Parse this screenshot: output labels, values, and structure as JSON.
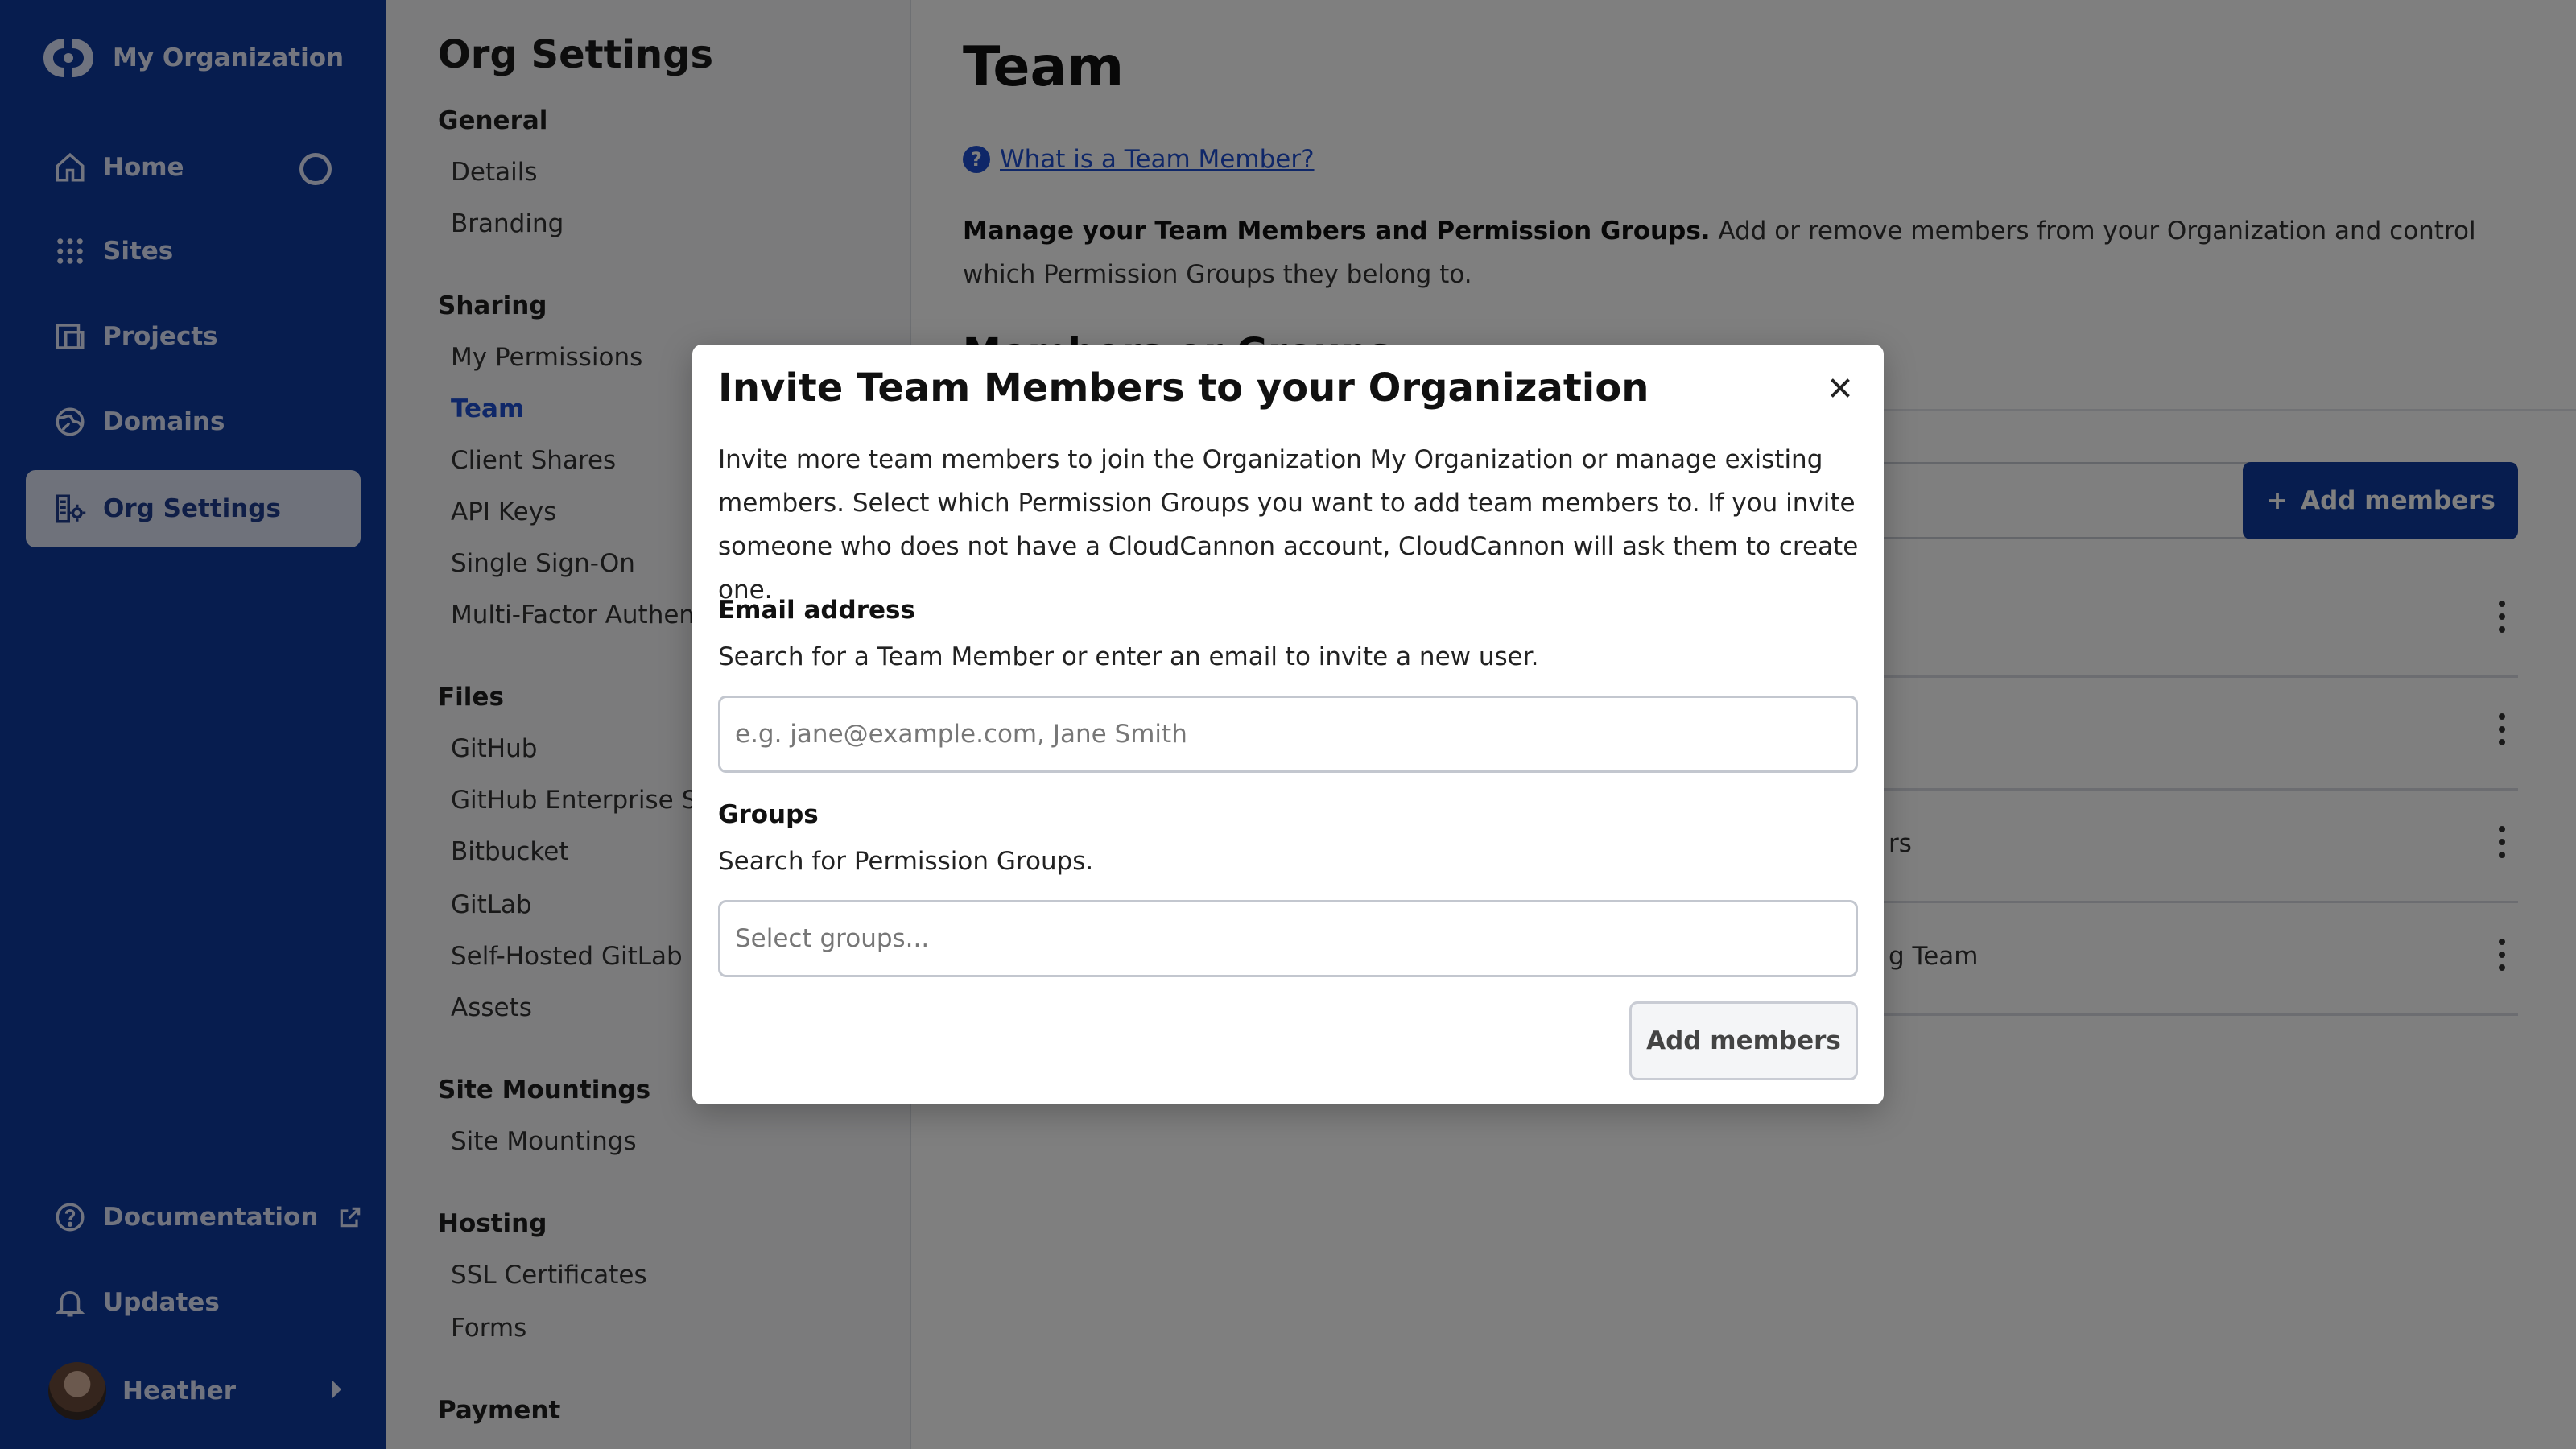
{
  "sidebar": {
    "org_name": "My Organization",
    "nav": [
      {
        "label": "Home",
        "icon": "home-icon"
      },
      {
        "label": "Sites",
        "icon": "grid-icon"
      },
      {
        "label": "Projects",
        "icon": "projects-icon"
      },
      {
        "label": "Domains",
        "icon": "globe-icon"
      },
      {
        "label": "Org Settings",
        "icon": "org-settings-icon",
        "active": true
      }
    ],
    "bottom": [
      {
        "label": "Documentation",
        "icon": "help-circle-icon"
      },
      {
        "label": "Updates",
        "icon": "bell-icon"
      }
    ],
    "user_name": "Heather",
    "colors": {
      "background": "#0e3a9e",
      "active_bg": "#dfe5f6"
    }
  },
  "settings": {
    "title": "Org Settings",
    "sections": [
      {
        "title": "General",
        "links": [
          "Details",
          "Branding"
        ]
      },
      {
        "title": "Sharing",
        "links": [
          "My Permissions",
          "Team",
          "Client Shares",
          "API Keys",
          "Single Sign-On",
          "Multi-Factor Authentication"
        ]
      },
      {
        "title": "Files",
        "links": [
          "GitHub",
          "GitHub Enterprise Server",
          "Bitbucket",
          "GitLab",
          "Self-Hosted GitLab",
          "Assets"
        ]
      },
      {
        "title": "Site Mountings",
        "links": [
          "Site Mountings"
        ]
      },
      {
        "title": "Hosting",
        "links": [
          "SSL Certificates",
          "Forms"
        ]
      },
      {
        "title": "Payment",
        "links": []
      }
    ],
    "active_link": "Team"
  },
  "main": {
    "title": "Team",
    "help_link": "What is a Team Member?",
    "intro_bold": "Manage your Team Members and Permission Groups.",
    "intro_rest": " Add or remove members from your Organization and control which Permission Groups they belong to.",
    "subtitle": "Members or Groups",
    "add_members_label": "Add members",
    "rows": [
      "",
      "",
      "rs",
      "g Team"
    ]
  },
  "modal": {
    "title": "Invite Team Members to your Organization",
    "description": "Invite more team members to join the Organization My Organization or manage existing members. Select which Permission Groups you want to add team members to. If you invite someone who does not have a CloudCannon account, CloudCannon will ask them to create one.",
    "email_label": "Email address",
    "email_hint": "Search for a Team Member or enter an email to invite a new user.",
    "email_placeholder": "e.g. jane@example.com, Jane Smith",
    "email_value": "",
    "groups_label": "Groups",
    "groups_hint": "Search for Permission Groups.",
    "groups_placeholder": "Select groups...",
    "groups_value": "",
    "submit_label": "Add members"
  }
}
